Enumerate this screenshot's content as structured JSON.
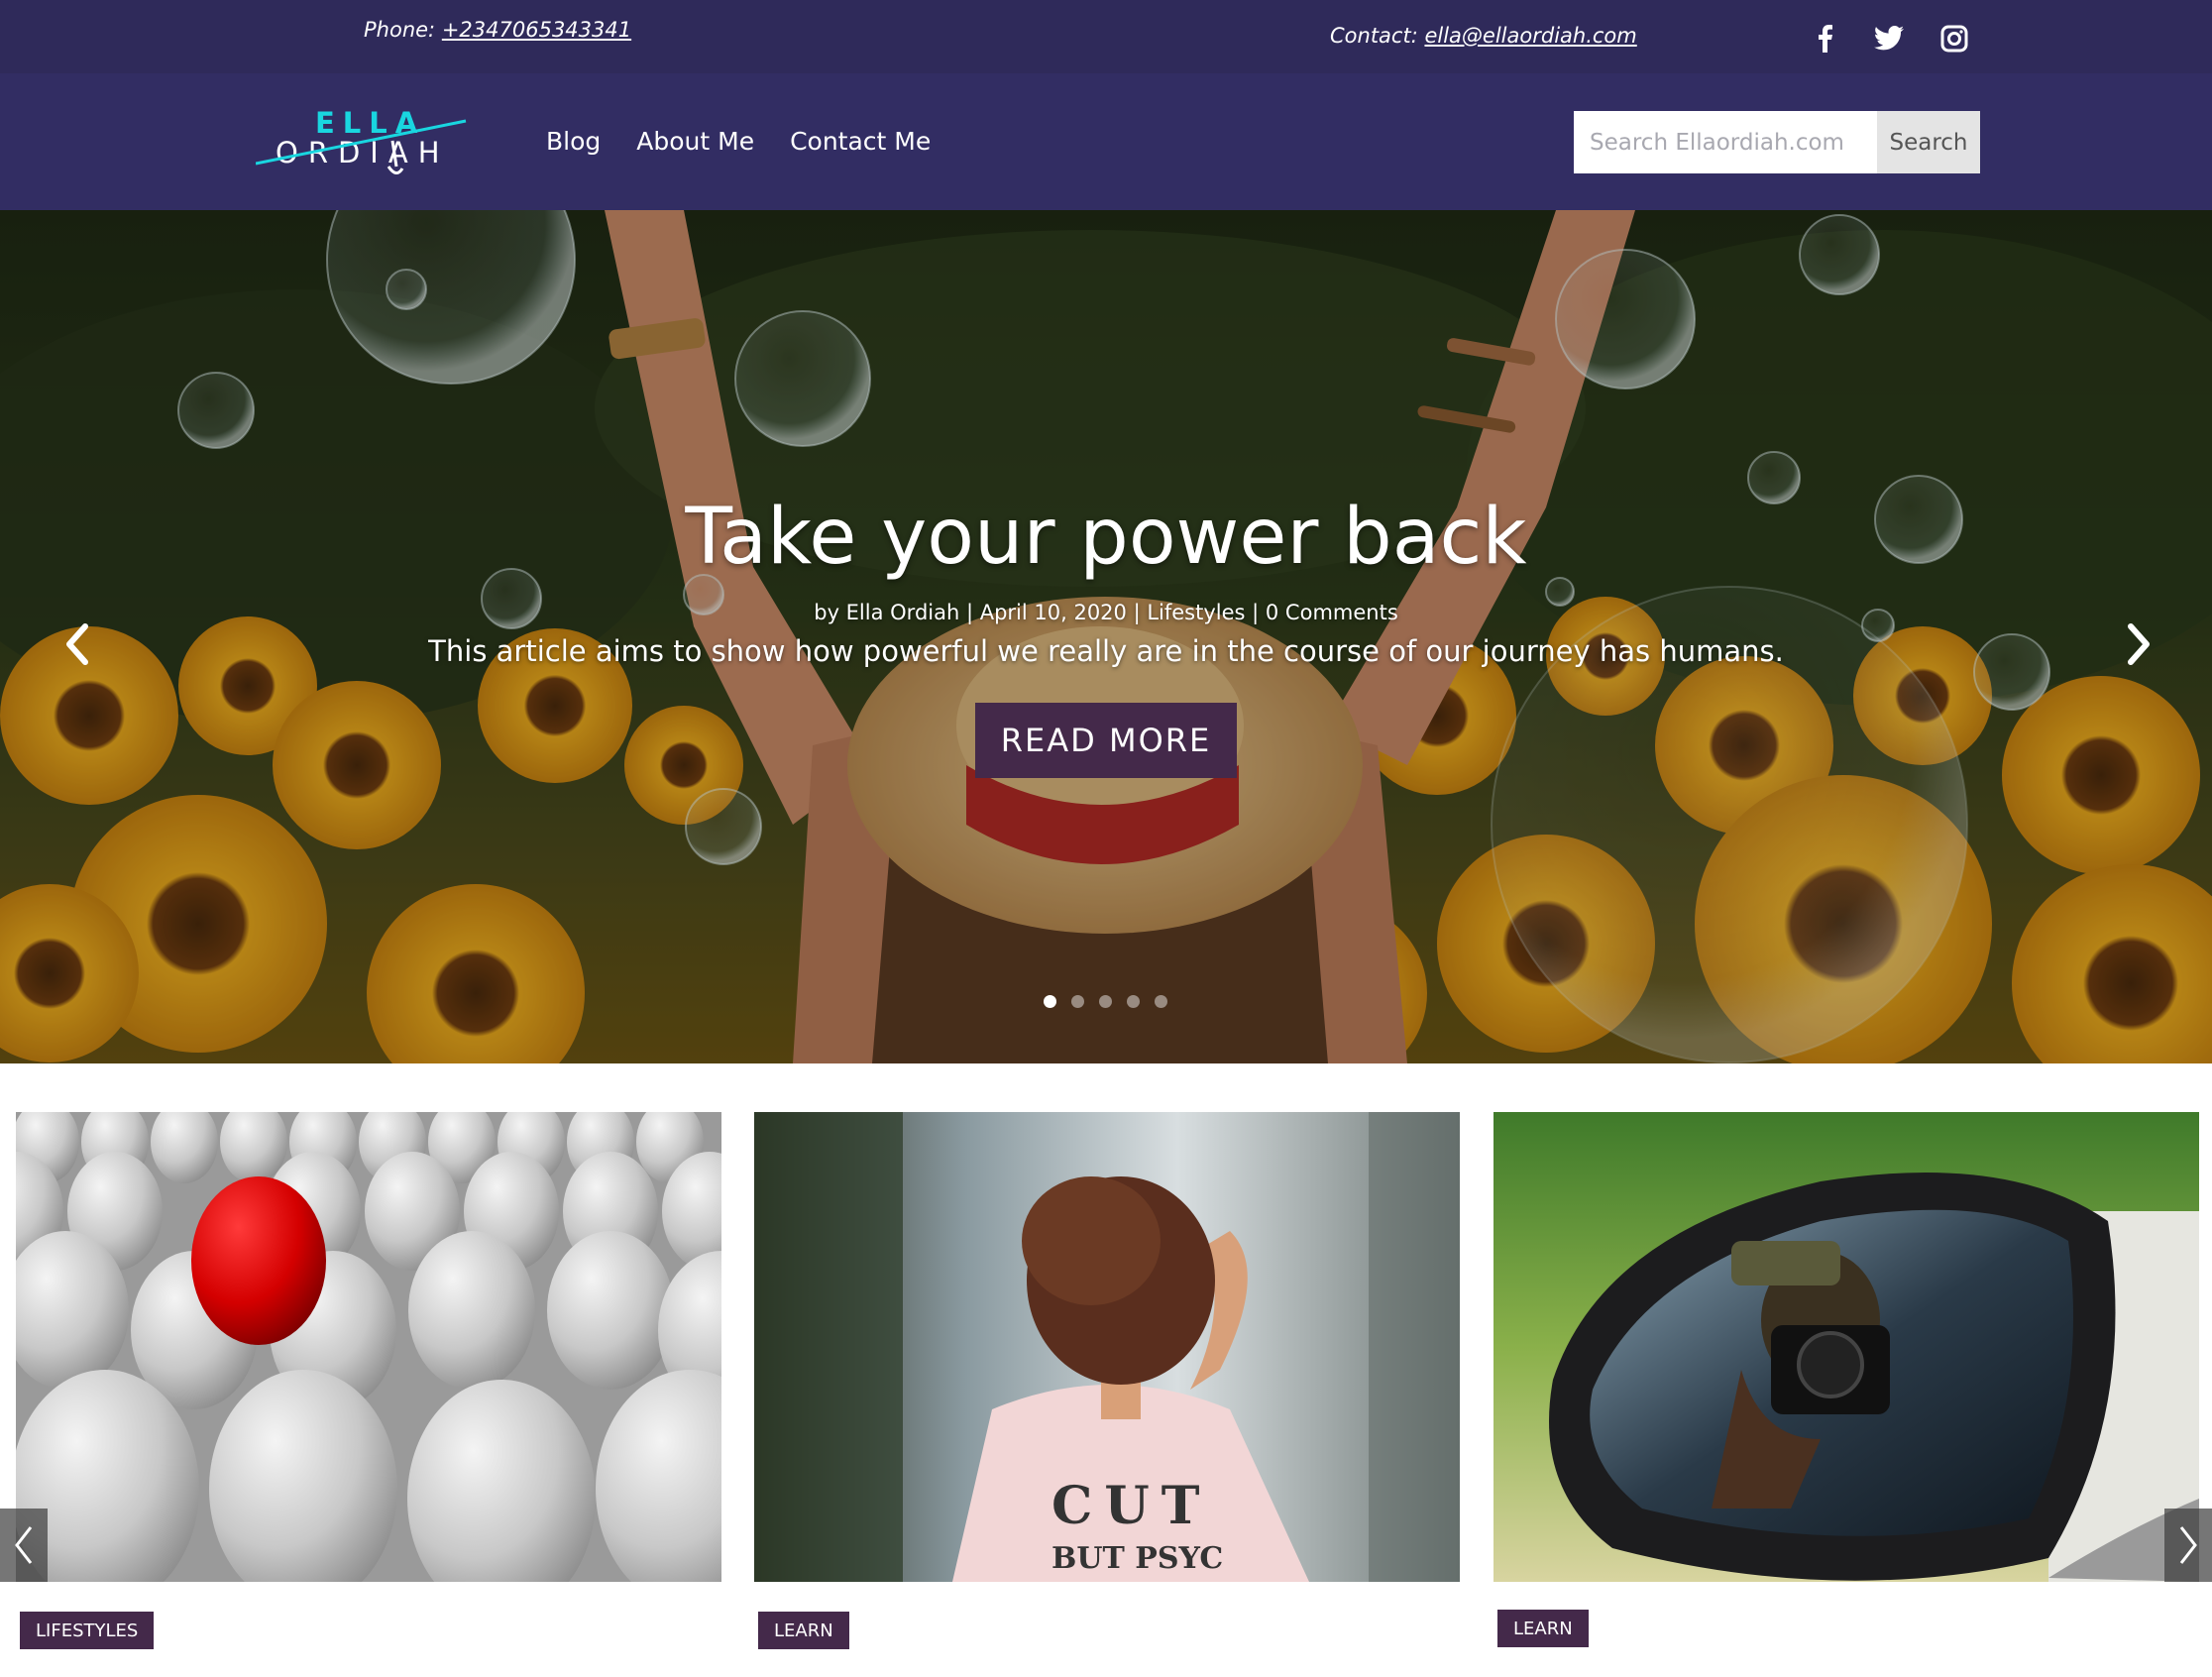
{
  "topbar": {
    "phone_label": "Phone:",
    "phone": "+2347065343341",
    "contact_label": "Contact:",
    "email": "ella@ellaordiah.com",
    "social": [
      "facebook-icon",
      "twitter-icon",
      "instagram-icon"
    ]
  },
  "brand": {
    "name_top": "ELLA",
    "name_bottom": "ORDIAH",
    "color_accent": "#19d6e0"
  },
  "nav": {
    "items": [
      {
        "label": "Blog"
      },
      {
        "label": "About Me"
      },
      {
        "label": "Contact Me"
      }
    ],
    "search_placeholder": "Search Ellaordiah.com",
    "search_button": "Search"
  },
  "hero": {
    "title": "Take your power back",
    "meta": "by Ella Ordiah | April 10, 2020 | Lifestyles | 0 Comments",
    "excerpt": "This article aims to show how powerful we really are in the course of our journey has humans.",
    "button": "READ MORE",
    "slide_count": 5,
    "active_slide": 1
  },
  "posts": [
    {
      "category": "LIFESTYLES"
    },
    {
      "category": "LEARN"
    },
    {
      "category": "LEARN"
    }
  ],
  "colors": {
    "topbar": "#2f2a5a",
    "navbar": "#322d63",
    "button": "#44294a"
  }
}
